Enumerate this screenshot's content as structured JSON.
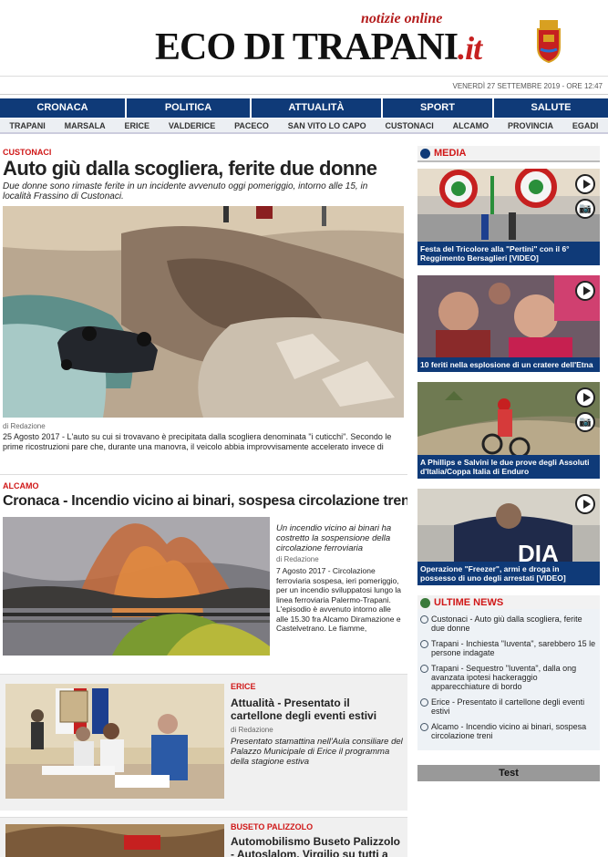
{
  "header": {
    "tagline": "notizie online",
    "logo_main": "ECO DI TRAPANI",
    "logo_suffix": ".it",
    "date": "VENERDÌ 27 SETTEMBRE 2019 - ORE 12:47"
  },
  "nav": [
    "CRONACA",
    "POLITICA",
    "ATTUALITÀ",
    "SPORT",
    "SALUTE"
  ],
  "subnav": [
    "TRAPANI",
    "MARSALA",
    "ERICE",
    "VALDERICE",
    "PACECO",
    "SAN VITO LO CAPO",
    "CUSTONACI",
    "ALCAMO",
    "PROVINCIA",
    "EGADI"
  ],
  "articles": [
    {
      "category": "CUSTONACI",
      "title": "Auto giù dalla scogliera, ferite due donne",
      "subtitle": "Due donne sono rimaste ferite in un incidente avvenuto oggi pomeriggio, intorno alle 15, in località Frassino di Custonaci.",
      "byline": "di Redazione",
      "text": "25 Agosto 2017 - L'auto su cui si trovavano è precipitata dalla scogliera denominata \"i cuticchi\". Secondo le prime ricostruzioni pare che, durante una manovra, il veicolo abbia improvvisamente accelerato invece di"
    },
    {
      "category": "ALCAMO",
      "title": "Cronaca - Incendio vicino ai binari, sospesa circolazione treni",
      "subtitle": "Un incendio vicino ai binari ha costretto la sospensione della circolazione ferroviaria",
      "byline": "di Redazione",
      "text": "7 Agosto 2017 - Circolazione ferroviaria sospesa, ieri pomeriggio, per un incendio sviluppatosi lungo la linea ferroviaria Palermo-Trapani. L'episodio è avvenuto intorno alle alle 15.30 fra Alcamo Diramazione e Castelvetrano. Le fiamme,"
    },
    {
      "category": "ERICE",
      "title": "Attualità - Presentato il cartellone degli eventi estivi",
      "byline": "di Redazione",
      "subtitle": "Presentato stamattina nell'Aula consiliare del Palazzo Municipale di Erice il programma della stagione estiva"
    },
    {
      "category": "BUSETO PALIZZOLO",
      "title": "Automobilismo Buseto Palizzolo - Autoslalom, Virgilio su tutti a Prizzi"
    }
  ],
  "sidebar": {
    "media_title": "MEDIA",
    "media": [
      {
        "caption": "Festa del Tricolore alla \"Pertini\" con il 6° Reggimento Bersaglieri [VIDEO]",
        "icon": "play-icon"
      },
      {
        "caption": "10 feriti nella esplosione di un cratere dell'Etna",
        "icon": "play-icon"
      },
      {
        "caption": "A Phillips e Salvini le due prove degli Assoluti d'Italia/Coppa Italia di Enduro",
        "icon": "play-icon"
      },
      {
        "caption": "Operazione \"Freezer\", armi e droga in possesso di uno degli arrestati [VIDEO]",
        "icon": "play-icon"
      }
    ],
    "news_title": "ULTIME NEWS",
    "news": [
      "Custonaci - Auto giù dalla scogliera, ferite due donne",
      "Trapani - Inchiesta \"Iuventa\", sarebbero 15 le persone indagate",
      "Trapani - Sequestro \"Iuventa\", dalla ong avanzata ipotesi hackeraggio apparecchiature di bordo",
      "Erice - Presentato il cartellone degli eventi estivi",
      "Alcamo - Incendio vicino ai binari, sospesa circolazione treni"
    ],
    "test_label": "Test"
  },
  "colors": {
    "nav": "#0f3a78",
    "accent": "#d01818"
  }
}
